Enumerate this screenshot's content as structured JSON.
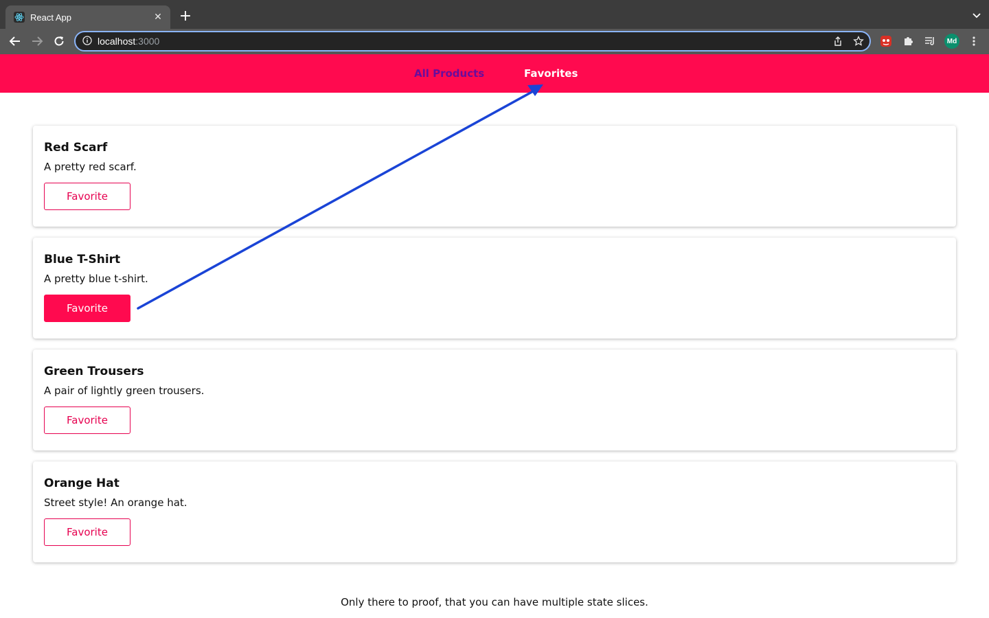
{
  "browser": {
    "tab": {
      "title": "React App",
      "favicon": "react-logo-icon",
      "close": "✕"
    },
    "new_tab": "+",
    "url": {
      "host": "localhost",
      "port": ":3000"
    },
    "profile_initials": "Md"
  },
  "header": {
    "nav": [
      {
        "label": "All Products"
      },
      {
        "label": "Favorites"
      }
    ],
    "colors": {
      "background": "#ff0a4f",
      "inactive": "#6a0c9c",
      "active": "#ffffff"
    }
  },
  "products": [
    {
      "title": "Red Scarf",
      "description": "A pretty red scarf.",
      "button": "Favorite",
      "is_favorite": false
    },
    {
      "title": "Blue T-Shirt",
      "description": "A pretty blue t-shirt.",
      "button": "Favorite",
      "is_favorite": true
    },
    {
      "title": "Green Trousers",
      "description": "A pair of lightly green trousers.",
      "button": "Favorite",
      "is_favorite": false
    },
    {
      "title": "Orange Hat",
      "description": "Street style! An orange hat.",
      "button": "Favorite",
      "is_favorite": false
    }
  ],
  "footer": {
    "note": "Only there to proof, that you can have multiple state slices."
  },
  "annotation": {
    "type": "arrow",
    "from": "Blue T-Shirt favorite button",
    "to": "Favorites nav link",
    "color": "#1a44d6"
  }
}
